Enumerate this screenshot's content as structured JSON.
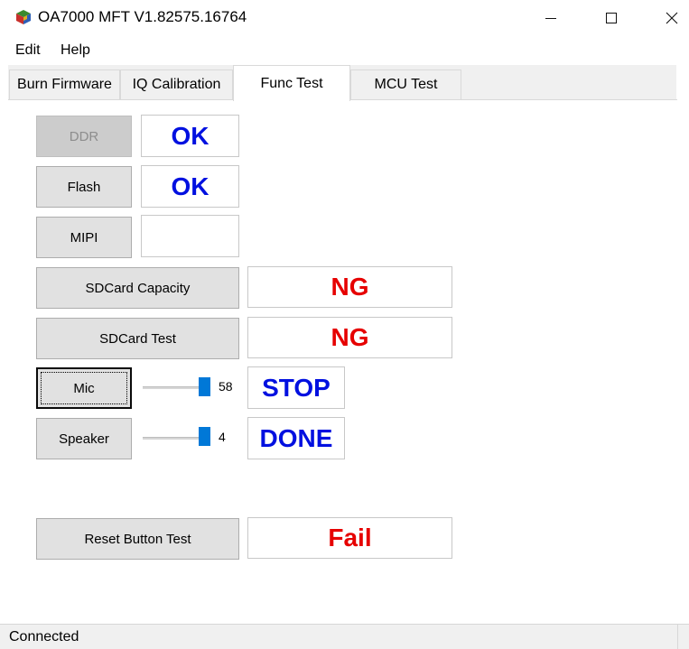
{
  "window": {
    "title": "OA7000 MFT V1.82575.16764",
    "app_icon": "cube-app-icon",
    "controls": {
      "minimize": "minimize-icon",
      "maximize": "maximize-icon",
      "close": "close-icon"
    }
  },
  "menu": {
    "items": [
      {
        "label": "Edit"
      },
      {
        "label": "Help"
      }
    ]
  },
  "tabs": [
    {
      "label": "Burn Firmware"
    },
    {
      "label": "IQ Calibration"
    },
    {
      "label": "Func Test",
      "active": true
    },
    {
      "label": "MCU Test"
    }
  ],
  "func_test": {
    "ddr": {
      "button": "DDR",
      "enabled": false,
      "result": "OK",
      "result_color": "#0010e0"
    },
    "flash": {
      "button": "Flash",
      "result": "OK",
      "result_color": "#0010e0"
    },
    "mipi": {
      "button": "MIPI",
      "result": ""
    },
    "sdcard_capacity": {
      "button": "SDCard Capacity",
      "result": "NG",
      "result_color": "#e60000"
    },
    "sdcard_test": {
      "button": "SDCard Test",
      "result": "NG",
      "result_color": "#e60000"
    },
    "mic": {
      "button": "Mic",
      "slider_value": "58",
      "result": "STOP",
      "result_color": "#0010e0"
    },
    "speaker": {
      "button": "Speaker",
      "slider_value": "4",
      "result": "DONE",
      "result_color": "#0010e0"
    },
    "reset_button": {
      "button": "Reset Button Test",
      "result": "Fail",
      "result_color": "#e60000"
    }
  },
  "status": {
    "text": "Connected"
  },
  "colors": {
    "ok_blue": "#0010e0",
    "fail_red": "#e60000",
    "slider_accent": "#0078d7"
  }
}
